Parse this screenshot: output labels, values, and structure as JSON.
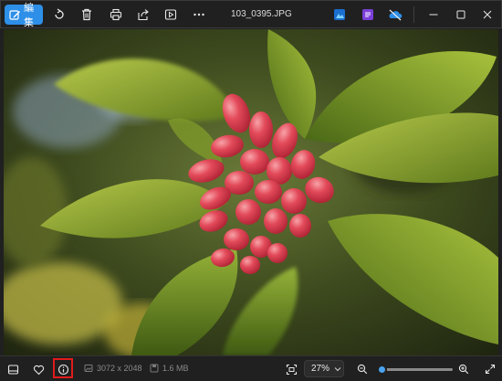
{
  "toolbar": {
    "edit_label": "編集",
    "filename": "103_0395.JPG"
  },
  "status": {
    "dimensions": "3072 x 2048",
    "file_size": "1.6 MB",
    "zoom": "27%",
    "zoom_fraction": 0.05
  },
  "icons": {
    "edit": "edit-icon",
    "rotate": "rotate-icon",
    "delete": "trash-icon",
    "print": "printer-icon",
    "share": "share-icon",
    "slideshow": "slideshow-icon",
    "more": "more-icon",
    "app1": "photos-app-icon",
    "app2": "clipchamp-icon",
    "app3": "onedrive-icon",
    "minimize": "minimize-icon",
    "maximize": "maximize-icon",
    "close": "close-icon"
  },
  "colors": {
    "accent": "#2d8fe8",
    "highlight": "#e01b1b",
    "background": "#202020"
  }
}
